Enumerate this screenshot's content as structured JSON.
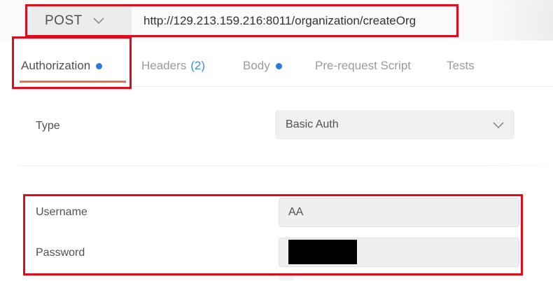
{
  "request": {
    "method": "POST",
    "url": "http://129.213.159.216:8011/organization/createOrg"
  },
  "tabs": [
    {
      "label": "Authorization",
      "active": true,
      "dot": true
    },
    {
      "label": "Headers",
      "count": "(2)"
    },
    {
      "label": "Body",
      "dot": true
    },
    {
      "label": "Pre-request Script"
    },
    {
      "label": "Tests"
    }
  ],
  "auth": {
    "type_label": "Type",
    "type_value": "Basic Auth",
    "username_label": "Username",
    "username_value": "AA",
    "password_label": "Password"
  },
  "colors": {
    "accent_underline": "#f26b3a",
    "indicator_dot": "#2a78e4",
    "annotation": "#e10b1b"
  },
  "icons": [
    "chevron-down-icon"
  ]
}
